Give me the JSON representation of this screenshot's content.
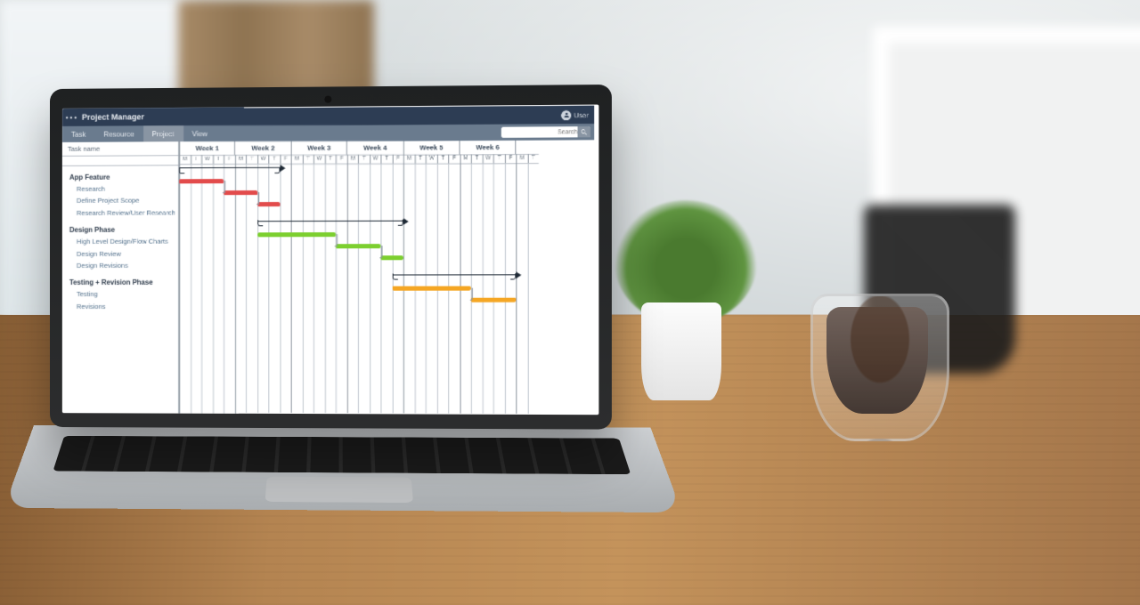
{
  "app": {
    "title": "Project Manager",
    "user_label": "User"
  },
  "menu": {
    "items": [
      "Task",
      "Resource",
      "Project",
      "View"
    ],
    "active_index": 2,
    "search_placeholder": "Search"
  },
  "sidebar": {
    "header": "Task name"
  },
  "timeline": {
    "weeks": [
      "Week 1",
      "Week 2",
      "Week 3",
      "Week 4",
      "Week 5",
      "Week 6"
    ],
    "days": [
      "M",
      "T",
      "W",
      "T",
      "F",
      "M",
      "T",
      "W",
      "T",
      "F",
      "M",
      "T",
      "W",
      "T",
      "F",
      "M",
      "T",
      "W",
      "T",
      "F",
      "M",
      "T",
      "W",
      "T",
      "F",
      "M",
      "T",
      "W",
      "T",
      "F",
      "M",
      "T"
    ],
    "col_w": 12.5,
    "week_cols": 5
  },
  "groups": [
    {
      "name": "App Feature",
      "bracket": {
        "start": 0,
        "end": 9
      },
      "tasks": [
        {
          "name": "Research",
          "start": 0,
          "end": 4,
          "color": "red"
        },
        {
          "name": "Define Project Scope",
          "start": 4,
          "end": 7,
          "color": "red"
        },
        {
          "name": "Research Review/User Research",
          "start": 7,
          "end": 9,
          "color": "red"
        }
      ]
    },
    {
      "name": "Design Phase",
      "bracket": {
        "start": 7,
        "end": 20
      },
      "tasks": [
        {
          "name": "High Level Design/Flow Charts",
          "start": 7,
          "end": 14,
          "color": "green"
        },
        {
          "name": "Design Review",
          "start": 14,
          "end": 18,
          "color": "green"
        },
        {
          "name": "Design Revisions",
          "start": 18,
          "end": 20,
          "color": "green"
        }
      ]
    },
    {
      "name": "Testing + Revision Phase",
      "bracket": {
        "start": 19,
        "end": 30
      },
      "tasks": [
        {
          "name": "Testing",
          "start": 19,
          "end": 26,
          "color": "orange"
        },
        {
          "name": "Revisions",
          "start": 26,
          "end": 30,
          "color": "orange"
        }
      ]
    }
  ],
  "chart_data": {
    "type": "gantt",
    "x_unit": "workday",
    "x_range": [
      0,
      32
    ],
    "week_labels": [
      "Week 1",
      "Week 2",
      "Week 3",
      "Week 4",
      "Week 5",
      "Week 6"
    ],
    "series": [
      {
        "group": "App Feature",
        "task": "Research",
        "start": 0,
        "end": 4,
        "color": "#e24b4b"
      },
      {
        "group": "App Feature",
        "task": "Define Project Scope",
        "start": 4,
        "end": 7,
        "color": "#e24b4b"
      },
      {
        "group": "App Feature",
        "task": "Research Review/User Research",
        "start": 7,
        "end": 9,
        "color": "#e24b4b"
      },
      {
        "group": "Design Phase",
        "task": "High Level Design/Flow Charts",
        "start": 7,
        "end": 14,
        "color": "#7ccf2f"
      },
      {
        "group": "Design Phase",
        "task": "Design Review",
        "start": 14,
        "end": 18,
        "color": "#7ccf2f"
      },
      {
        "group": "Design Phase",
        "task": "Design Revisions",
        "start": 18,
        "end": 20,
        "color": "#7ccf2f"
      },
      {
        "group": "Testing + Revision Phase",
        "task": "Testing",
        "start": 19,
        "end": 26,
        "color": "#f5a623"
      },
      {
        "group": "Testing + Revision Phase",
        "task": "Revisions",
        "start": 26,
        "end": 30,
        "color": "#f5a623"
      }
    ]
  }
}
